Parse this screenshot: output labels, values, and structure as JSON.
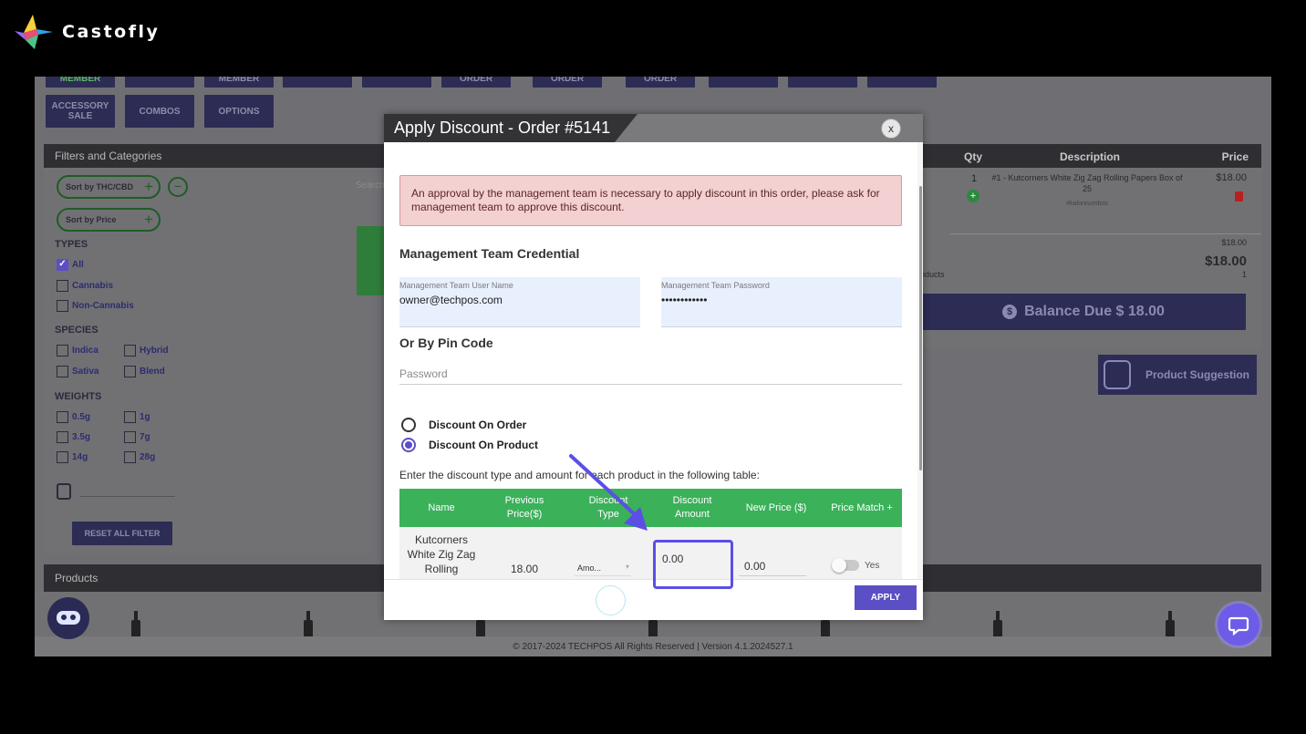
{
  "brand": {
    "name": "Castofly"
  },
  "toolbar": {
    "row1": [
      "MEMBER",
      "",
      "MEMBER",
      "",
      "",
      "ORDER",
      "ORDER",
      "ORDER",
      "",
      "",
      ""
    ],
    "row2": [
      "ACCESSORY SALE",
      "COMBOS",
      "OPTIONS"
    ]
  },
  "filters": {
    "header": "Filters and Categories",
    "sort_thc": "Sort by THC/CBD",
    "sort_price": "Sort by Price",
    "search_placeholder": "Search",
    "types_title": "TYPES",
    "types": [
      "All",
      "Cannabis",
      "Non-Cannabis"
    ],
    "species_title": "SPECIES",
    "species": [
      "Indica",
      "Hybrid",
      "Sativa",
      "Blend"
    ],
    "weights_title": "WEIGHTS",
    "weights": [
      "0.5g",
      "1g",
      "3.5g",
      "7g",
      "14g",
      "28g"
    ],
    "reset_label": "RESET ALL FILTER"
  },
  "cart": {
    "col_qty": "Qty",
    "col_description": "Description",
    "col_price": "Price",
    "item_qty": "1",
    "item_description": "#1 - Kutcorners White Zig Zag Rolling Papers Box of 25",
    "item_sub": "#kalonnumbos",
    "item_price": "$18.00",
    "subtotal": "$18.00",
    "total": "$18.00",
    "products_label": "Products",
    "products_count": "1",
    "balance_label": "Balance Due $ 18.00",
    "suggestion_label": "Product Suggestion"
  },
  "products": {
    "header": "Products"
  },
  "footer": {
    "text": "© 2017-2024 TECHPOS All Rights Reserved | Version 4.1.2024527.1"
  },
  "modal": {
    "title": "Apply Discount - Order #5141",
    "close": "x",
    "alert": "An approval by the management team is necessary to apply discount in this order, please ask for management team to approve this discount.",
    "credential_title": "Management Team Credential",
    "username_label": "Management Team User Name",
    "username_value": "owner@techpos.com",
    "password_label": "Management Team Password",
    "password_value": "••••••••••••",
    "pin_title": "Or By Pin Code",
    "pin_placeholder": "Password",
    "radio_order": "Discount On Order",
    "radio_product": "Discount On Product",
    "instructions": "Enter the discount type and amount for each product in the following table:",
    "table_headers": [
      "Name",
      "Previous Price($)",
      "Discount Type",
      "Discount Amount",
      "New Price ($)",
      "Price Match +"
    ],
    "row": {
      "name": "Kutcorners White Zig Zag Rolling",
      "previous_price": "18.00",
      "discount_type": "Amo...",
      "discount_amount": "0.00",
      "new_price": "0.00",
      "price_match": "Yes"
    },
    "apply_label": "APPLY"
  }
}
